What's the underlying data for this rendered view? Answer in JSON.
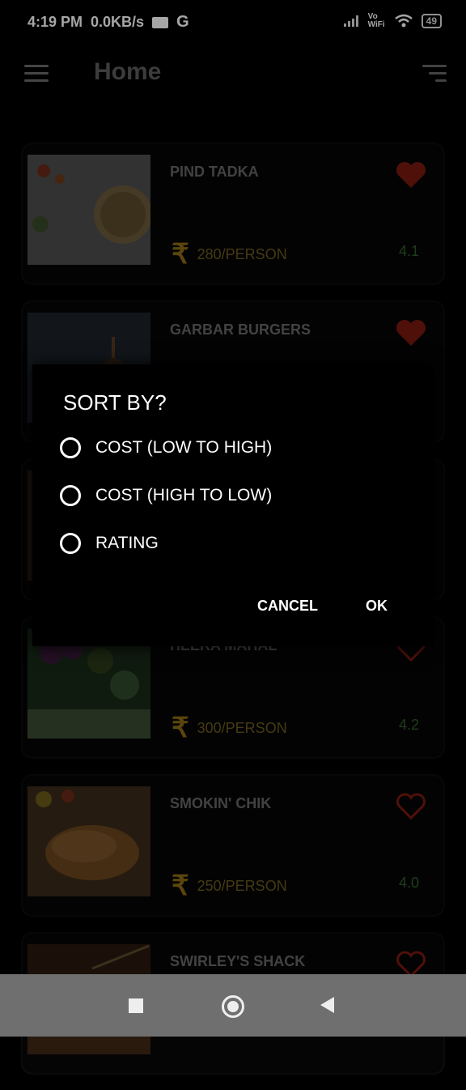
{
  "status_bar": {
    "time": "4:19 PM",
    "network": "0.0KB/s",
    "g_label": "G",
    "wifi_label": "Vo WiFi",
    "battery": "49"
  },
  "appbar": {
    "title": "Home",
    "menu_icon": "menu-icon",
    "sort_icon": "sort-icon"
  },
  "restaurants": [
    {
      "name": "PIND TADKA",
      "price": "280/PERSON",
      "rating": "4.1",
      "favorite": true
    },
    {
      "name": "GARBAR BURGERS",
      "price": "",
      "rating": "",
      "favorite": true
    },
    {
      "name": "",
      "price": "",
      "rating": "",
      "favorite": false
    },
    {
      "name": "HEERA MAHAL",
      "price": "300/PERSON",
      "rating": "4.2",
      "favorite": false
    },
    {
      "name": "SMOKIN' CHIK",
      "price": "250/PERSON",
      "rating": "4.0",
      "favorite": false
    },
    {
      "name": "SWIRLEY'S SHACK",
      "price": "",
      "rating": "",
      "favorite": false
    }
  ],
  "currency_symbol": "₹",
  "dialog": {
    "title": "SORT BY?",
    "options": [
      "COST (LOW TO HIGH)",
      "COST (HIGH TO LOW)",
      "RATING"
    ],
    "cancel_label": "CANCEL",
    "ok_label": "OK"
  },
  "colors": {
    "heart": "#7a1a10",
    "rating": "#2f5f2a",
    "price": "#6a5a1c"
  }
}
